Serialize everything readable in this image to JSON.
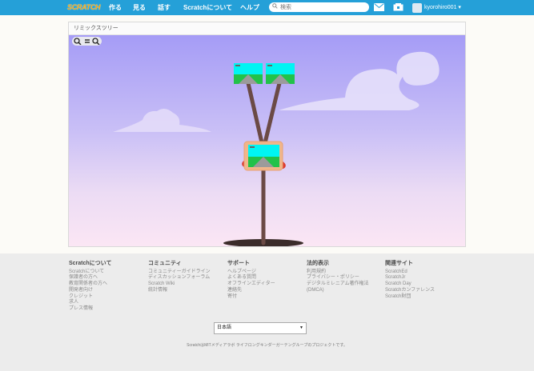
{
  "nav": {
    "logo": "SCRATCH",
    "create": "作る",
    "explore": "見る",
    "discuss": "話す",
    "about": "Scratchについて",
    "help": "ヘルプ",
    "search_placeholder": "検索",
    "username": "kyorohiro001 ▾"
  },
  "panel": {
    "title": "リミックスツリー"
  },
  "tree": {
    "zoom_in": "+",
    "zoom_reset": "=",
    "zoom_out": "-",
    "colors": {
      "trunk": "#6b4a45",
      "sky_top": "#a59cf6",
      "sky_bottom": "#fbe6f4",
      "thumb_sky": "#00f5f3",
      "thumb_grass": "#22c24a",
      "highlight": "#f0b68a"
    }
  },
  "footer": {
    "columns": [
      {
        "heading": "Scratchについて",
        "links": [
          "Scratchについて",
          "保護者の方へ",
          "教育関係者の方へ",
          "開発者向け",
          "クレジット",
          "求人",
          "プレス情報"
        ]
      },
      {
        "heading": "コミュニティ",
        "links": [
          "コミュニティーガイドライン",
          "ディスカッションフォーラム",
          "Scratch Wiki",
          "統計情報"
        ]
      },
      {
        "heading": "サポート",
        "links": [
          "ヘルプページ",
          "よくある質問",
          "オフラインエディター",
          "連絡先",
          "寄付"
        ]
      },
      {
        "heading": "法的表示",
        "links": [
          "利用規約",
          "プライバシー・ポリシー",
          "デジタルミレニアム著作権法",
          "(DMCA)"
        ]
      },
      {
        "heading": "関連サイト",
        "links": [
          "ScratchEd",
          "ScratchJr",
          "Scratch Day",
          "Scratchカンファレンス",
          "Scratch財団"
        ]
      }
    ],
    "language": "日本語",
    "copyright": "ScratchはMITメディアラボ ライフロングキンダーガーテングループのプロジェクトです。"
  }
}
